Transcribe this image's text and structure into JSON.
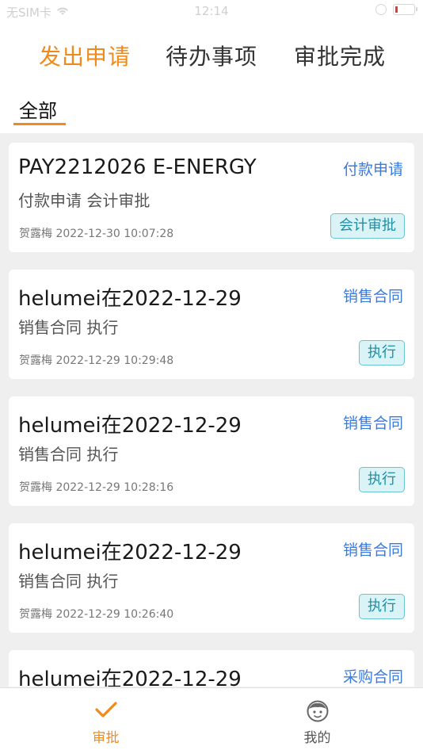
{
  "status_bar": {
    "carrier": "无SIM卡",
    "time": "12:14"
  },
  "tabs": [
    {
      "label": "发出申请",
      "active": true
    },
    {
      "label": "待办事项",
      "active": false
    },
    {
      "label": "审批完成",
      "active": false
    }
  ],
  "filter": {
    "label": "全部"
  },
  "records": [
    {
      "title": "PAY2212026 E-ENERGY",
      "type": "付款申请",
      "desc": "付款申请 会计审批",
      "meta": "贺露梅 2022-12-30 10:07:28",
      "badge": "会计审批"
    },
    {
      "title": "helumei在2022-12-29",
      "type": "销售合同",
      "desc": "销售合同 执行",
      "meta": "贺露梅 2022-12-29 10:29:48",
      "badge": "执行"
    },
    {
      "title": "helumei在2022-12-29",
      "type": "销售合同",
      "desc": "销售合同 执行",
      "meta": "贺露梅 2022-12-29 10:28:16",
      "badge": "执行"
    },
    {
      "title": "helumei在2022-12-29",
      "type": "销售合同",
      "desc": "销售合同 执行",
      "meta": "贺露梅 2022-12-29 10:26:40",
      "badge": "执行"
    },
    {
      "title": "helumei在2022-12-29",
      "type": "采购合同",
      "desc": "",
      "meta": "",
      "badge": ""
    }
  ],
  "bottom_nav": [
    {
      "label": "审批",
      "icon": "checkmark-icon",
      "active": true
    },
    {
      "label": "我的",
      "icon": "face-icon",
      "active": false
    }
  ],
  "colors": {
    "accent": "#f08a1c",
    "link": "#3b7be0",
    "badge_bg": "#d9f3f6",
    "badge_text": "#1f8fa3"
  }
}
